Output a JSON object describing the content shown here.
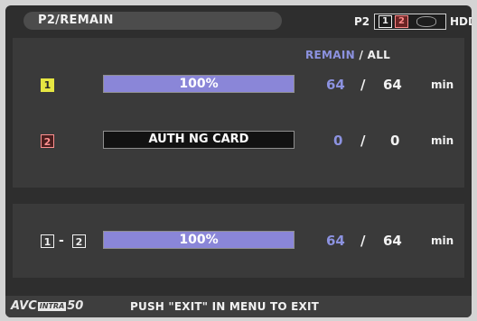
{
  "header": {
    "title": "P2/REMAIN",
    "p2_label": "P2",
    "slot1_indicator": "1",
    "slot2_indicator": "2",
    "hdd_label": "HDD"
  },
  "columns": {
    "remain": "REMAIN",
    "separator": "/",
    "all": "ALL"
  },
  "slots": [
    {
      "slot": "1",
      "status_text": "100%",
      "fill_fraction": 1.0,
      "remain": "64",
      "separator": "/",
      "all": "64",
      "unit": "min"
    },
    {
      "slot": "2",
      "status_text": "AUTH NG CARD",
      "fill_fraction": 0,
      "remain": "0",
      "separator": "/",
      "all": "0",
      "unit": "min"
    }
  ],
  "total": {
    "from_slot": "1",
    "dash": "-",
    "to_slot": "2",
    "status_text": "100%",
    "fill_fraction": 1.0,
    "remain": "64",
    "separator": "/",
    "all": "64",
    "unit": "min"
  },
  "footer": {
    "codec_avc": "AVC",
    "codec_intra": "INTRA",
    "codec_rate": "50",
    "message": "PUSH \"EXIT\" IN MENU TO EXIT"
  },
  "colors": {
    "remain_blue": "#8c92e0",
    "bar_fill": "#8a86d8",
    "slot1_yellow": "#e6e642",
    "slot2_red": "#ff9090"
  }
}
